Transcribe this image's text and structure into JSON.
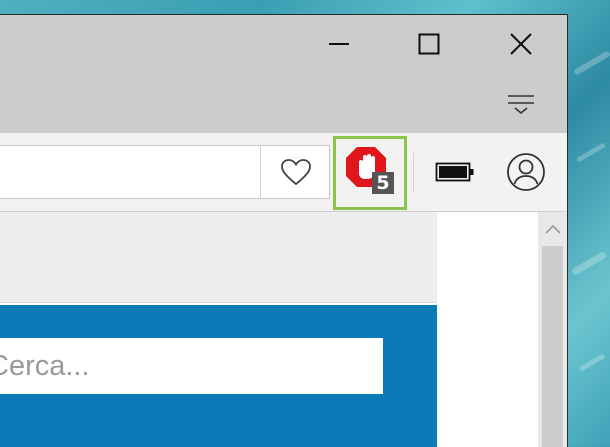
{
  "window": {
    "minimize_icon": "minimize-icon",
    "maximize_icon": "maximize-icon",
    "close_icon": "close-icon",
    "hub_icon": "filter-menu-icon"
  },
  "toolbar": {
    "favorite_icon": "heart-icon",
    "extension": {
      "icon": "adblock-stop-hand-icon",
      "badge_count": "5",
      "highlight_color": "#8cc34a",
      "icon_color": "#e0161d"
    },
    "battery_icon": "battery-icon",
    "profile_icon": "user-avatar-icon"
  },
  "page": {
    "search_placeholder": "Cerca...",
    "brand_color": "#0a7bb6"
  },
  "scrollbar": {
    "up_icon": "chevron-up-icon"
  }
}
